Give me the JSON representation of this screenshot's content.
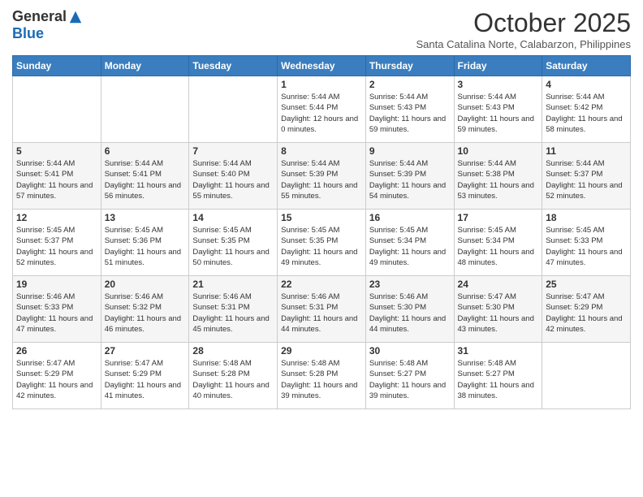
{
  "logo": {
    "general": "General",
    "blue": "Blue"
  },
  "title": {
    "month": "October 2025",
    "location": "Santa Catalina Norte, Calabarzon, Philippines"
  },
  "days_of_week": [
    "Sunday",
    "Monday",
    "Tuesday",
    "Wednesday",
    "Thursday",
    "Friday",
    "Saturday"
  ],
  "weeks": [
    [
      {
        "day": "",
        "info": ""
      },
      {
        "day": "",
        "info": ""
      },
      {
        "day": "",
        "info": ""
      },
      {
        "day": "1",
        "info": "Sunrise: 5:44 AM\nSunset: 5:44 PM\nDaylight: 12 hours\nand 0 minutes."
      },
      {
        "day": "2",
        "info": "Sunrise: 5:44 AM\nSunset: 5:43 PM\nDaylight: 11 hours\nand 59 minutes."
      },
      {
        "day": "3",
        "info": "Sunrise: 5:44 AM\nSunset: 5:43 PM\nDaylight: 11 hours\nand 59 minutes."
      },
      {
        "day": "4",
        "info": "Sunrise: 5:44 AM\nSunset: 5:42 PM\nDaylight: 11 hours\nand 58 minutes."
      }
    ],
    [
      {
        "day": "5",
        "info": "Sunrise: 5:44 AM\nSunset: 5:41 PM\nDaylight: 11 hours\nand 57 minutes."
      },
      {
        "day": "6",
        "info": "Sunrise: 5:44 AM\nSunset: 5:41 PM\nDaylight: 11 hours\nand 56 minutes."
      },
      {
        "day": "7",
        "info": "Sunrise: 5:44 AM\nSunset: 5:40 PM\nDaylight: 11 hours\nand 55 minutes."
      },
      {
        "day": "8",
        "info": "Sunrise: 5:44 AM\nSunset: 5:39 PM\nDaylight: 11 hours\nand 55 minutes."
      },
      {
        "day": "9",
        "info": "Sunrise: 5:44 AM\nSunset: 5:39 PM\nDaylight: 11 hours\nand 54 minutes."
      },
      {
        "day": "10",
        "info": "Sunrise: 5:44 AM\nSunset: 5:38 PM\nDaylight: 11 hours\nand 53 minutes."
      },
      {
        "day": "11",
        "info": "Sunrise: 5:44 AM\nSunset: 5:37 PM\nDaylight: 11 hours\nand 52 minutes."
      }
    ],
    [
      {
        "day": "12",
        "info": "Sunrise: 5:45 AM\nSunset: 5:37 PM\nDaylight: 11 hours\nand 52 minutes."
      },
      {
        "day": "13",
        "info": "Sunrise: 5:45 AM\nSunset: 5:36 PM\nDaylight: 11 hours\nand 51 minutes."
      },
      {
        "day": "14",
        "info": "Sunrise: 5:45 AM\nSunset: 5:35 PM\nDaylight: 11 hours\nand 50 minutes."
      },
      {
        "day": "15",
        "info": "Sunrise: 5:45 AM\nSunset: 5:35 PM\nDaylight: 11 hours\nand 49 minutes."
      },
      {
        "day": "16",
        "info": "Sunrise: 5:45 AM\nSunset: 5:34 PM\nDaylight: 11 hours\nand 49 minutes."
      },
      {
        "day": "17",
        "info": "Sunrise: 5:45 AM\nSunset: 5:34 PM\nDaylight: 11 hours\nand 48 minutes."
      },
      {
        "day": "18",
        "info": "Sunrise: 5:45 AM\nSunset: 5:33 PM\nDaylight: 11 hours\nand 47 minutes."
      }
    ],
    [
      {
        "day": "19",
        "info": "Sunrise: 5:46 AM\nSunset: 5:33 PM\nDaylight: 11 hours\nand 47 minutes."
      },
      {
        "day": "20",
        "info": "Sunrise: 5:46 AM\nSunset: 5:32 PM\nDaylight: 11 hours\nand 46 minutes."
      },
      {
        "day": "21",
        "info": "Sunrise: 5:46 AM\nSunset: 5:31 PM\nDaylight: 11 hours\nand 45 minutes."
      },
      {
        "day": "22",
        "info": "Sunrise: 5:46 AM\nSunset: 5:31 PM\nDaylight: 11 hours\nand 44 minutes."
      },
      {
        "day": "23",
        "info": "Sunrise: 5:46 AM\nSunset: 5:30 PM\nDaylight: 11 hours\nand 44 minutes."
      },
      {
        "day": "24",
        "info": "Sunrise: 5:47 AM\nSunset: 5:30 PM\nDaylight: 11 hours\nand 43 minutes."
      },
      {
        "day": "25",
        "info": "Sunrise: 5:47 AM\nSunset: 5:29 PM\nDaylight: 11 hours\nand 42 minutes."
      }
    ],
    [
      {
        "day": "26",
        "info": "Sunrise: 5:47 AM\nSunset: 5:29 PM\nDaylight: 11 hours\nand 42 minutes."
      },
      {
        "day": "27",
        "info": "Sunrise: 5:47 AM\nSunset: 5:29 PM\nDaylight: 11 hours\nand 41 minutes."
      },
      {
        "day": "28",
        "info": "Sunrise: 5:48 AM\nSunset: 5:28 PM\nDaylight: 11 hours\nand 40 minutes."
      },
      {
        "day": "29",
        "info": "Sunrise: 5:48 AM\nSunset: 5:28 PM\nDaylight: 11 hours\nand 39 minutes."
      },
      {
        "day": "30",
        "info": "Sunrise: 5:48 AM\nSunset: 5:27 PM\nDaylight: 11 hours\nand 39 minutes."
      },
      {
        "day": "31",
        "info": "Sunrise: 5:48 AM\nSunset: 5:27 PM\nDaylight: 11 hours\nand 38 minutes."
      },
      {
        "day": "",
        "info": ""
      }
    ]
  ]
}
